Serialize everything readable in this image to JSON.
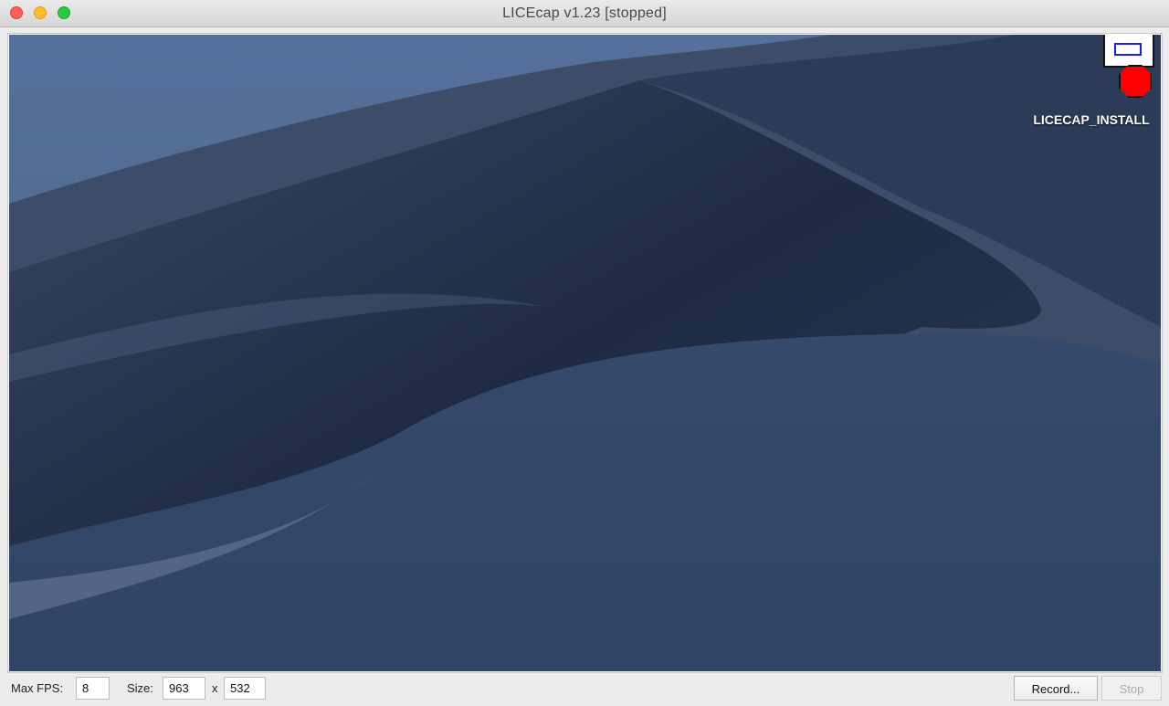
{
  "window": {
    "title": "LICEcap v1.23 [stopped]",
    "controls": [
      "close",
      "minimize",
      "maximize"
    ]
  },
  "desktop": {
    "wallpaper": "Mojave dunes at night",
    "icon": {
      "label": "LICECAP_INSTALL",
      "icon_semantic": "licecap-installer-icon"
    }
  },
  "controls": {
    "max_fps_label": "Max FPS:",
    "max_fps_value": "8",
    "size_label": "Size:",
    "width_value": "963",
    "size_separator": "x",
    "height_value": "532",
    "record_label": "Record...",
    "stop_label": "Stop"
  },
  "colors": {
    "close": "#fe5f57",
    "minimize": "#febc2e",
    "maximize": "#28c840",
    "record_red": "#ff0000",
    "board_blue": "#1a1aff"
  }
}
